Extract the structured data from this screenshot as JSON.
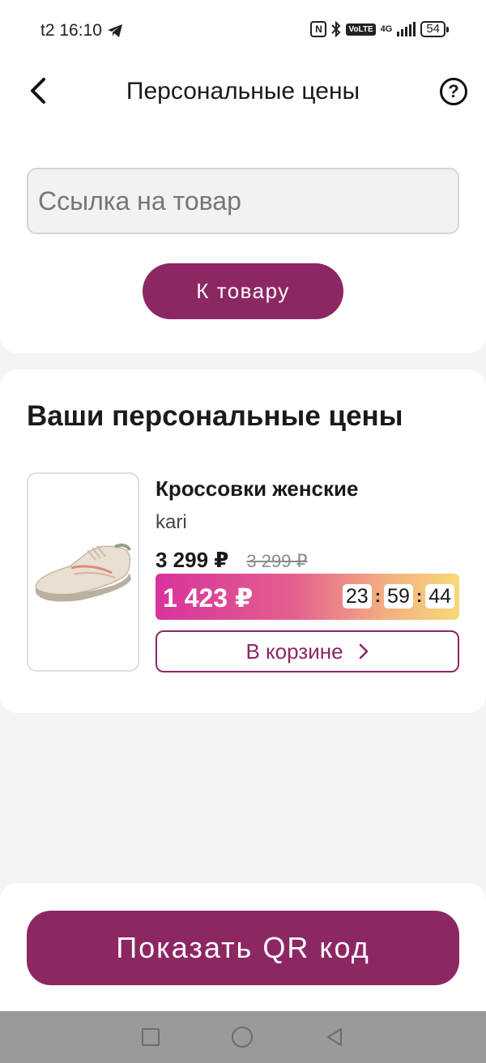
{
  "status_bar": {
    "carrier_time": "t2 16:10",
    "network": "4G",
    "volte": "VoLTE",
    "battery": "54"
  },
  "header": {
    "title": "Персональные цены",
    "help_label": "?"
  },
  "search": {
    "placeholder": "Ссылка на товар",
    "button_label": "К товару"
  },
  "prices": {
    "section_title": "Ваши персональные цены",
    "items": [
      {
        "name": "Кроссовки женские",
        "brand": "kari",
        "price": "3 299 ₽",
        "old_price": "3 299 ₽",
        "personal_price": "1 423 ₽",
        "timer": {
          "hours": "23",
          "minutes": "59",
          "seconds": "44",
          "separator": ":"
        },
        "cart_label": "В корзине",
        "image_icon": "sneaker-image"
      }
    ]
  },
  "footer": {
    "qr_button_label": "Показать QR код"
  },
  "colors": {
    "brand": "#8c2763",
    "promo_gradient_start": "#d8339c",
    "promo_gradient_end": "#f7d978"
  }
}
